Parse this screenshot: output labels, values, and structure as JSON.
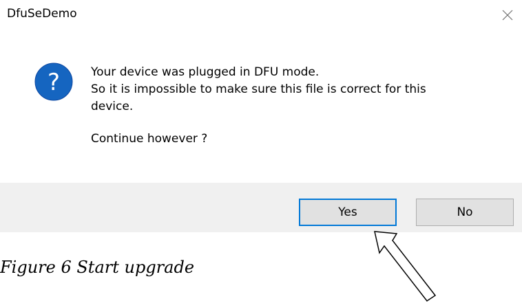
{
  "window": {
    "title": "DfuSeDemo",
    "close_icon": "close-icon"
  },
  "message": {
    "icon": "question-icon",
    "lines": [
      "Your device was plugged in DFU mode.",
      "So it is impossible to make sure this file is correct for this",
      "device."
    ],
    "question": "Continue however ?"
  },
  "buttons": {
    "yes_label": "Yes",
    "no_label": "No"
  },
  "caption": "Figure 6 Start upgrade",
  "colors": {
    "accent": "#0078d7",
    "footer_bg": "#f0f0f0",
    "button_bg": "#e1e1e1"
  }
}
